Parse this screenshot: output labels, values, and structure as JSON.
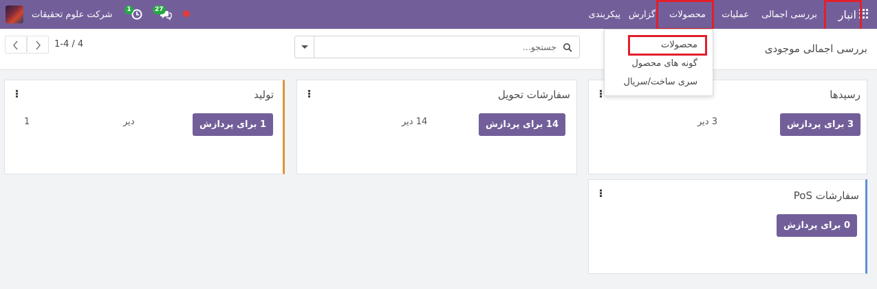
{
  "navbar": {
    "app_name": "انبار",
    "menu": [
      "بررسی اجمالی",
      "عملیات",
      "محصولات",
      "گزارش",
      "پیکربندی"
    ],
    "company": "شرکت علوم تحقیقات",
    "activity_badge": "1",
    "messages_badge": "27",
    "highlight_color": "#e01f2a",
    "brand_color": "#725f9a"
  },
  "control": {
    "title": "بررسی اجمالی موجودی",
    "search_placeholder": "جستجو...",
    "pager": "1-4 / 4"
  },
  "dropdown": {
    "items": [
      "محصولات",
      "گونه های محصول",
      "سری ساخت/سریال"
    ]
  },
  "cards": [
    {
      "title": "رسیدها",
      "button": "3 برای پردازش",
      "late": "3 دیر"
    },
    {
      "title": "سفارشات تحویل",
      "button": "14 برای پردازش",
      "late": "14 دیر"
    },
    {
      "title": "تولید",
      "button": "1 برای پردازش",
      "late_label": "دیر",
      "late_count": "1"
    },
    {
      "title": "سفارشات PoS",
      "button": "0 برای پردازش"
    }
  ],
  "icons": [
    "apps-grid-icon",
    "search-icon",
    "chevron-left-icon",
    "chevron-right-icon",
    "caret-down-icon",
    "kebab-menu-icon",
    "chat-icon",
    "clock-icon",
    "record-dot-icon"
  ]
}
